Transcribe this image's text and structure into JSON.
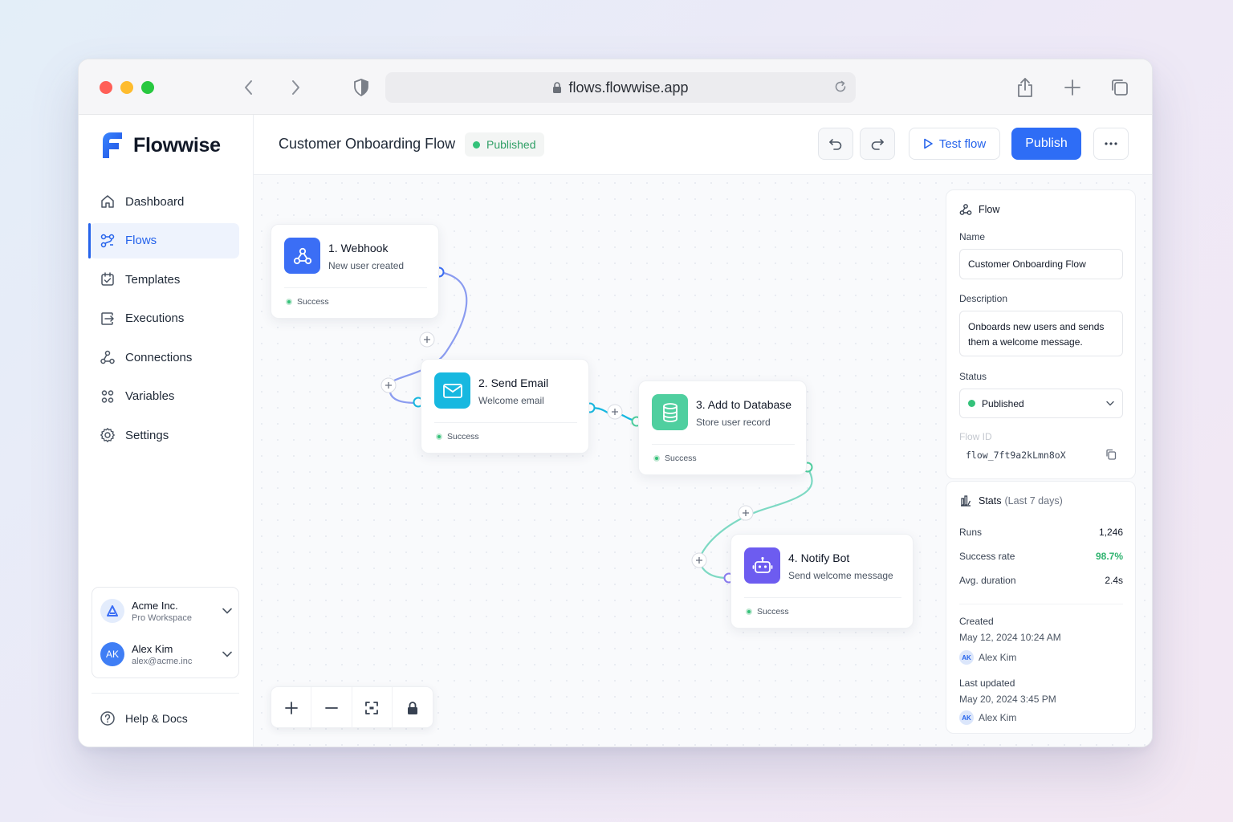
{
  "browser": {
    "url": "flows.flowwise.app"
  },
  "sidebar": {
    "brand": "Flowwise",
    "items": [
      {
        "label": "Dashboard",
        "icon": "home-icon"
      },
      {
        "label": "Flows",
        "icon": "flows-icon",
        "active": true
      },
      {
        "label": "Templates",
        "icon": "templates-icon"
      },
      {
        "label": "Executions",
        "icon": "executions-icon"
      },
      {
        "label": "Connections",
        "icon": "connections-icon"
      },
      {
        "label": "Variables",
        "icon": "variables-icon"
      },
      {
        "label": "Settings",
        "icon": "gear-icon"
      }
    ],
    "workspace": {
      "name": "Acme Inc.",
      "plan": "Pro Workspace"
    },
    "user": {
      "initials": "AK",
      "name": "Alex Kim",
      "email": "alex@acme.inc"
    },
    "help": "Help & Docs"
  },
  "header": {
    "title": "Customer Onboarding Flow",
    "status": "Published",
    "test_label": "Test flow",
    "publish_label": "Publish"
  },
  "nodes": [
    {
      "title": "1. Webhook",
      "subtitle": "New user created",
      "status": "Success",
      "icon": "webhook-icon",
      "color": "#3b6ef5"
    },
    {
      "title": "2. Send Email",
      "subtitle": "Welcome email",
      "status": "Success",
      "icon": "mail-icon",
      "color": "#17b8e0"
    },
    {
      "title": "3. Add to Database",
      "subtitle": "Store user record",
      "status": "Success",
      "icon": "database-icon",
      "color": "#4fcf9f"
    },
    {
      "title": "4. Notify Bot",
      "subtitle": "Send welcome message",
      "status": "Success",
      "icon": "bot-icon",
      "color": "#6d5cf0"
    }
  ],
  "panel": {
    "heading": "Flow",
    "name_label": "Name",
    "name_value": "Customer Onboarding Flow",
    "description_label": "Description",
    "description_value": "Onboards new users and sends them a welcome message.",
    "status_label": "Status",
    "status_value": "Published",
    "flow_id_label": "Flow ID",
    "flow_id_value": "flow_7ft9a2kLmn8oX"
  },
  "stats": {
    "heading": "Stats",
    "period": "(Last 7 days)",
    "runs_label": "Runs",
    "runs_value": "1,246",
    "success_label": "Success rate",
    "success_value": "98.7%",
    "duration_label": "Avg. duration",
    "duration_value": "2.4s",
    "created_label": "Created",
    "created_date": "May 12, 2024 10:24 AM",
    "created_by": "Alex Kim",
    "updated_label": "Last updated",
    "updated_date": "May 20, 2024 3:45 PM",
    "updated_by": "Alex Kim",
    "user_initials": "AK"
  },
  "colors": {
    "accent": "#2e6df6",
    "success": "#34c27a",
    "edge_blue": "#8b9cf0",
    "edge_teal": "#7dd9c3"
  }
}
